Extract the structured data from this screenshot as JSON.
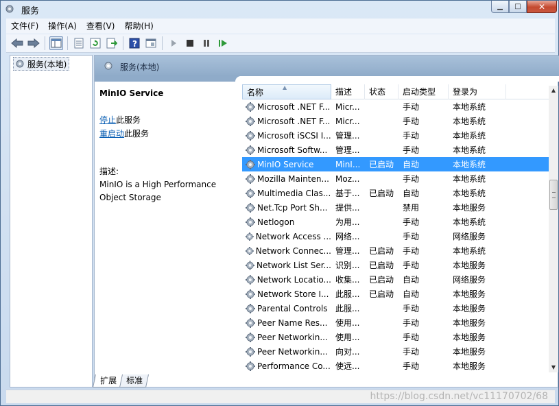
{
  "window": {
    "title": "服务"
  },
  "menu": [
    "文件(F)",
    "操作(A)",
    "查看(V)",
    "帮助(H)"
  ],
  "toolbar": {
    "icons": [
      "back-arrow-icon",
      "forward-arrow-icon",
      "console-tree-icon",
      "properties-icon",
      "refresh-icon",
      "export-list-icon",
      "help-icon",
      "view-icon",
      "start-service-icon",
      "stop-service-icon",
      "pause-service-icon",
      "restart-service-icon"
    ]
  },
  "tree": {
    "root_label": "服务(本地)"
  },
  "pane": {
    "header_title": "服务(本地)"
  },
  "details": {
    "service_name": "MinIO Service",
    "stop_link": "停止",
    "stop_suffix": "此服务",
    "restart_link": "重启动",
    "restart_suffix": "此服务",
    "desc_label": "描述:",
    "desc_text": "MinIO is a High Performance Object Storage"
  },
  "columns": [
    "名称",
    "描述",
    "状态",
    "启动类型",
    "登录为"
  ],
  "rows": [
    {
      "name": "Microsoft .NET F...",
      "desc": "Micr...",
      "status": "",
      "startup": "手动",
      "logon": "本地系统"
    },
    {
      "name": "Microsoft .NET F...",
      "desc": "Micr...",
      "status": "",
      "startup": "手动",
      "logon": "本地系统"
    },
    {
      "name": "Microsoft iSCSI I...",
      "desc": "管理...",
      "status": "",
      "startup": "手动",
      "logon": "本地系统"
    },
    {
      "name": "Microsoft Softw...",
      "desc": "管理...",
      "status": "",
      "startup": "手动",
      "logon": "本地系统"
    },
    {
      "name": "MinIO Service",
      "desc": "MinI...",
      "status": "已启动",
      "startup": "自动",
      "logon": "本地系统"
    },
    {
      "name": "Mozilla Mainten...",
      "desc": "Moz...",
      "status": "",
      "startup": "手动",
      "logon": "本地系统"
    },
    {
      "name": "Multimedia Clas...",
      "desc": "基于...",
      "status": "已启动",
      "startup": "自动",
      "logon": "本地系统"
    },
    {
      "name": "Net.Tcp Port Sh...",
      "desc": "提供...",
      "status": "",
      "startup": "禁用",
      "logon": "本地服务"
    },
    {
      "name": "Netlogon",
      "desc": "为用...",
      "status": "",
      "startup": "手动",
      "logon": "本地系统"
    },
    {
      "name": "Network Access ...",
      "desc": "网络...",
      "status": "",
      "startup": "手动",
      "logon": "网络服务"
    },
    {
      "name": "Network Connec...",
      "desc": "管理...",
      "status": "已启动",
      "startup": "手动",
      "logon": "本地系统"
    },
    {
      "name": "Network List Ser...",
      "desc": "识别...",
      "status": "已启动",
      "startup": "手动",
      "logon": "本地服务"
    },
    {
      "name": "Network Locatio...",
      "desc": "收集...",
      "status": "已启动",
      "startup": "自动",
      "logon": "网络服务"
    },
    {
      "name": "Network Store I...",
      "desc": "此服...",
      "status": "已启动",
      "startup": "自动",
      "logon": "本地服务"
    },
    {
      "name": "Parental Controls",
      "desc": "此服...",
      "status": "",
      "startup": "手动",
      "logon": "本地服务"
    },
    {
      "name": "Peer Name Res...",
      "desc": "使用...",
      "status": "",
      "startup": "手动",
      "logon": "本地服务"
    },
    {
      "name": "Peer Networkin...",
      "desc": "使用...",
      "status": "",
      "startup": "手动",
      "logon": "本地服务"
    },
    {
      "name": "Peer Networkin...",
      "desc": "向对...",
      "status": "",
      "startup": "手动",
      "logon": "本地服务"
    },
    {
      "name": "Performance Co...",
      "desc": "使远...",
      "status": "",
      "startup": "手动",
      "logon": "本地服务"
    }
  ],
  "selected_row": 4,
  "tabs": [
    "扩展",
    "标准"
  ],
  "active_tab": 0,
  "watermark": "https://blog.csdn.net/vc11170702/68",
  "colors": {
    "selection": "#3399ff",
    "link": "#0b5fb4",
    "header": "#8fabc9"
  }
}
